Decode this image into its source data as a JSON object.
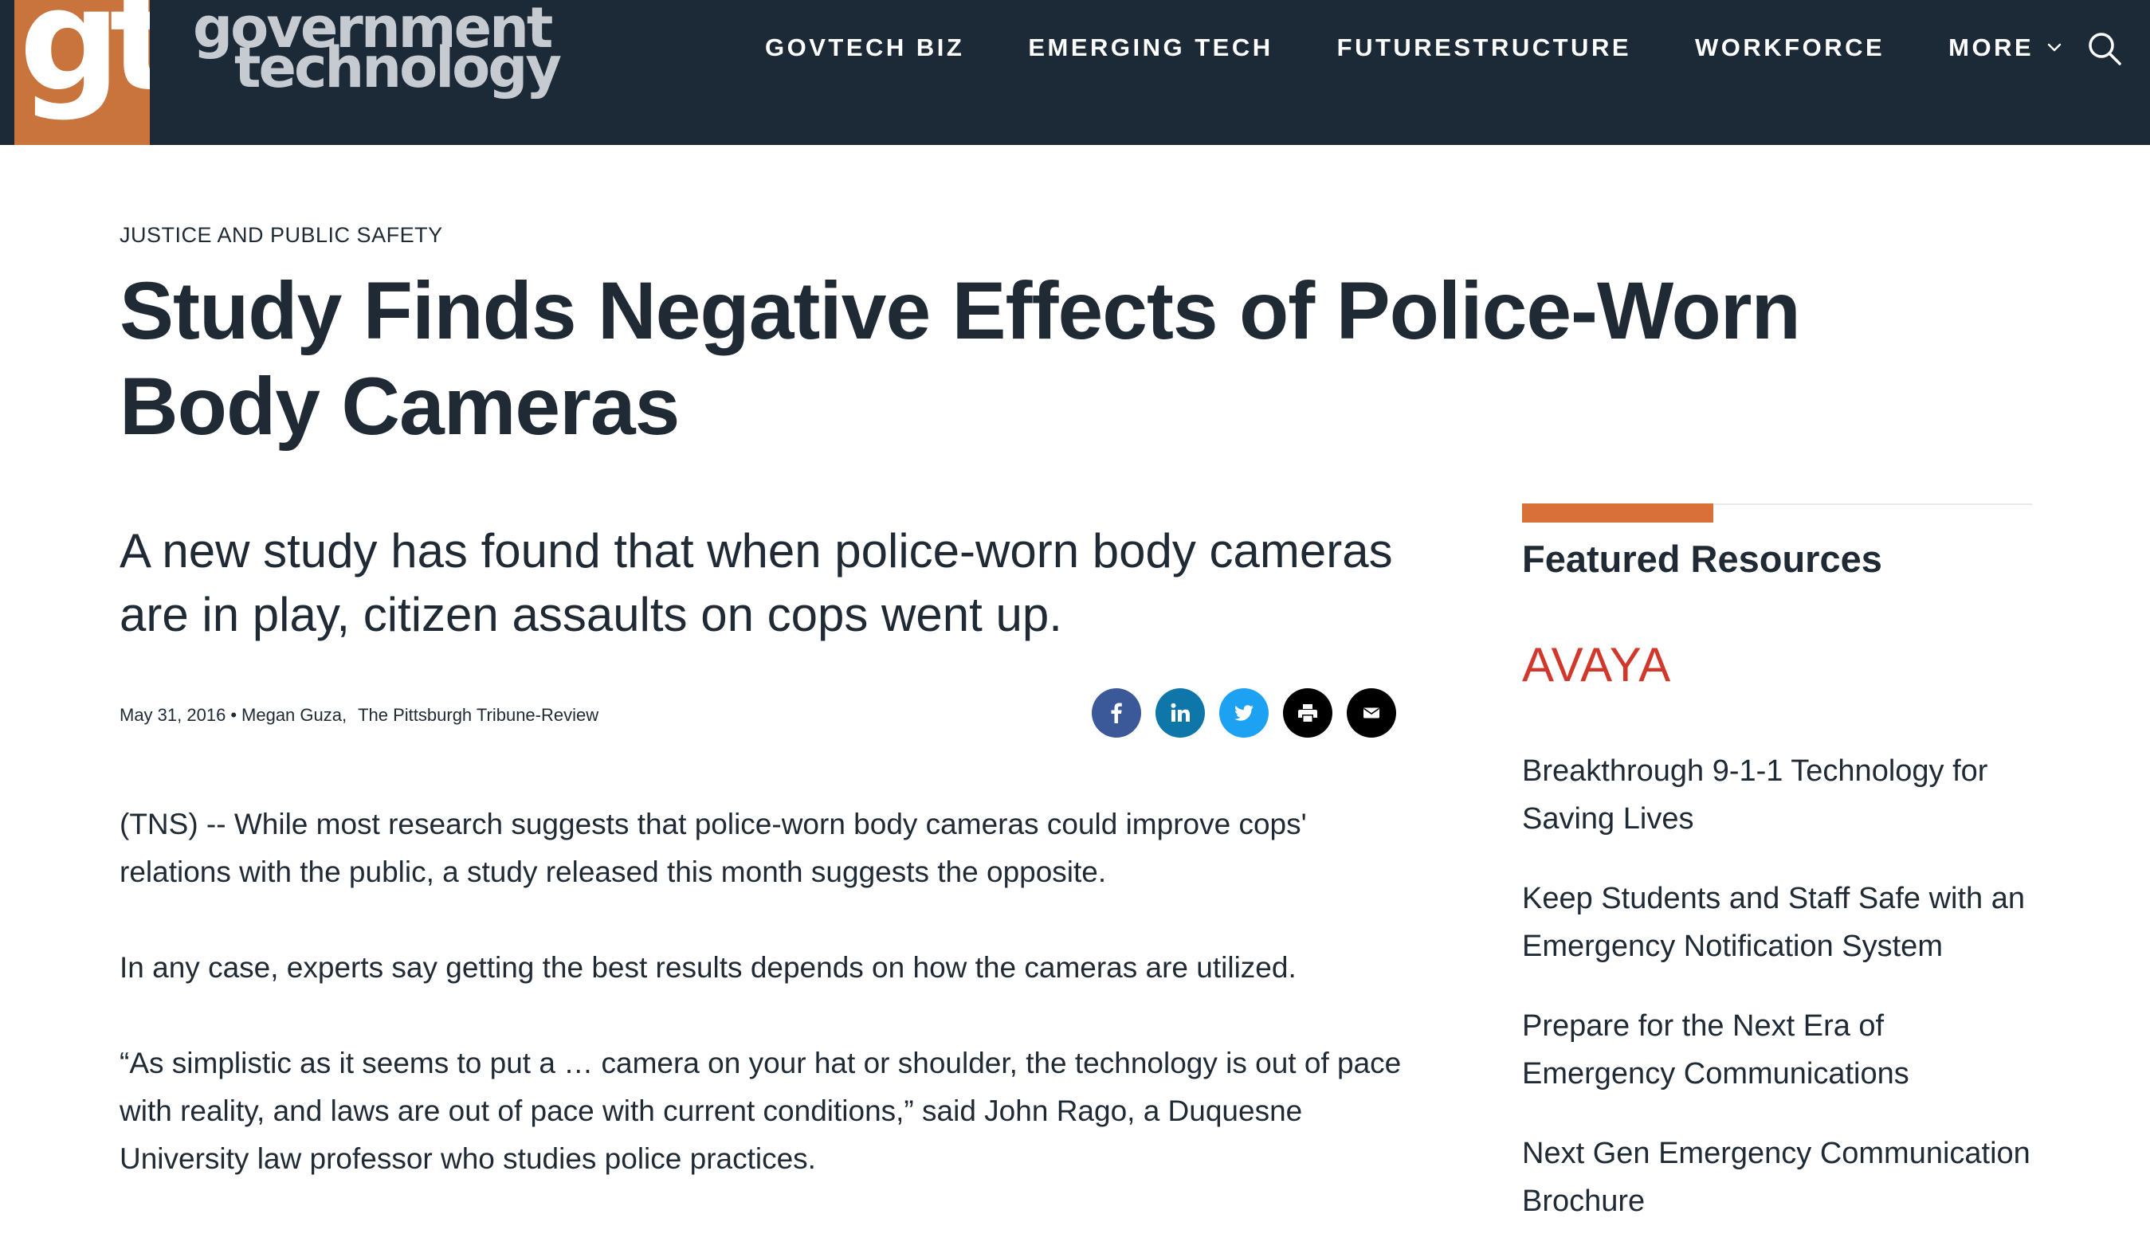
{
  "header": {
    "logo": {
      "mark": "gt",
      "word_line1": "government",
      "word_line2": "technology"
    },
    "nav": [
      {
        "label": "GOVTECH BIZ"
      },
      {
        "label": "EMERGING TECH"
      },
      {
        "label": "FUTURESTRUCTURE"
      },
      {
        "label": "WORKFORCE"
      },
      {
        "label": "MORE",
        "icon": "chevron-down-icon"
      }
    ],
    "search_icon": "search-icon",
    "colors": {
      "bar": "#1c2a37",
      "logo_box": "#c8743c"
    }
  },
  "article": {
    "category": "JUSTICE AND PUBLIC SAFETY",
    "title": "Study Finds Negative Effects of Police-Worn Body Cameras",
    "dek": "A new study has found that when police-worn body cameras are in play, citizen assaults on cops went up.",
    "date": "May 31, 2016",
    "author": "Megan Guza,",
    "source": "The Pittsburgh Tribune-Review",
    "share": [
      {
        "name": "facebook-icon",
        "color": "#3b5998"
      },
      {
        "name": "linkedin-icon",
        "color": "#0e76a8"
      },
      {
        "name": "twitter-icon",
        "color": "#1da1f2"
      },
      {
        "name": "print-icon",
        "color": "#000000"
      },
      {
        "name": "email-icon",
        "color": "#000000"
      }
    ],
    "paragraphs": [
      "(TNS) -- While most research suggests that police-worn body cameras could improve cops' relations with the public, a study released this month suggests the opposite.",
      "In any case, experts say getting the best results depends on how the cameras are utilized.",
      "“As simplistic as it seems to put a … camera on your hat or shoulder, the technology is out of pace with reality, and laws are out of pace with current conditions,” said John Rago, a Duquesne University law professor who studies police practices."
    ]
  },
  "sidebar": {
    "title": "Featured Resources",
    "sponsor_logo": "AVAYA",
    "accent_color": "#d9703a",
    "links": [
      "Breakthrough 9-1-1 Technology for Saving Lives",
      "Keep Students and Staff Safe with an Emergency Notification System",
      "Prepare for the Next Era of Emergency Communications",
      "Next Gen Emergency Communication Brochure"
    ]
  }
}
